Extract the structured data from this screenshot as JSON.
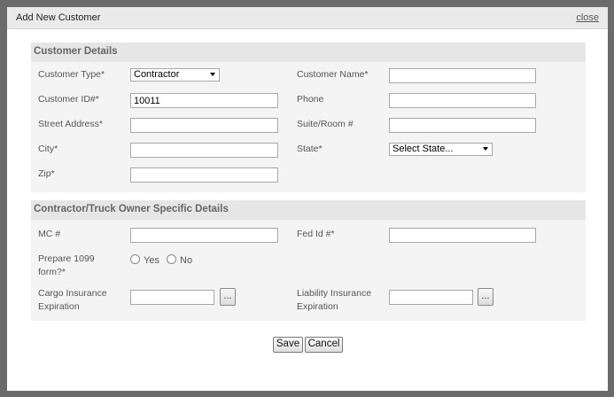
{
  "dialog": {
    "title": "Add New Customer",
    "close_label": "close"
  },
  "customer_details": {
    "heading": "Customer Details",
    "customer_type": {
      "label": "Customer Type*",
      "value": "Contractor"
    },
    "customer_name": {
      "label": "Customer Name*",
      "value": ""
    },
    "customer_id": {
      "label": "Customer ID#*",
      "value": "10011"
    },
    "phone": {
      "label": "Phone",
      "value": ""
    },
    "street_address": {
      "label": "Street Address*",
      "value": ""
    },
    "suite_room": {
      "label": "Suite/Room #",
      "value": ""
    },
    "city": {
      "label": "City*",
      "value": ""
    },
    "state": {
      "label": "State*",
      "value": "Select State..."
    },
    "zip": {
      "label": "Zip*",
      "value": ""
    }
  },
  "contractor_details": {
    "heading": "Contractor/Truck Owner Specific Details",
    "mc": {
      "label": "MC #",
      "value": ""
    },
    "fed_id": {
      "label": "Fed Id #*",
      "value": ""
    },
    "prepare_1099": {
      "label_line1": "Prepare 1099",
      "label_line2": "form?*",
      "yes_label": "Yes",
      "no_label": "No"
    },
    "cargo_insurance": {
      "label_line1": "Cargo Insurance",
      "label_line2": "Expiration",
      "value": "",
      "picker_label": "..."
    },
    "liability_insurance": {
      "label_line1": "Liability Insurance",
      "label_line2": "Expiration",
      "value": "",
      "picker_label": "..."
    }
  },
  "actions": {
    "save_label": "Save",
    "cancel_label": "Cancel"
  }
}
